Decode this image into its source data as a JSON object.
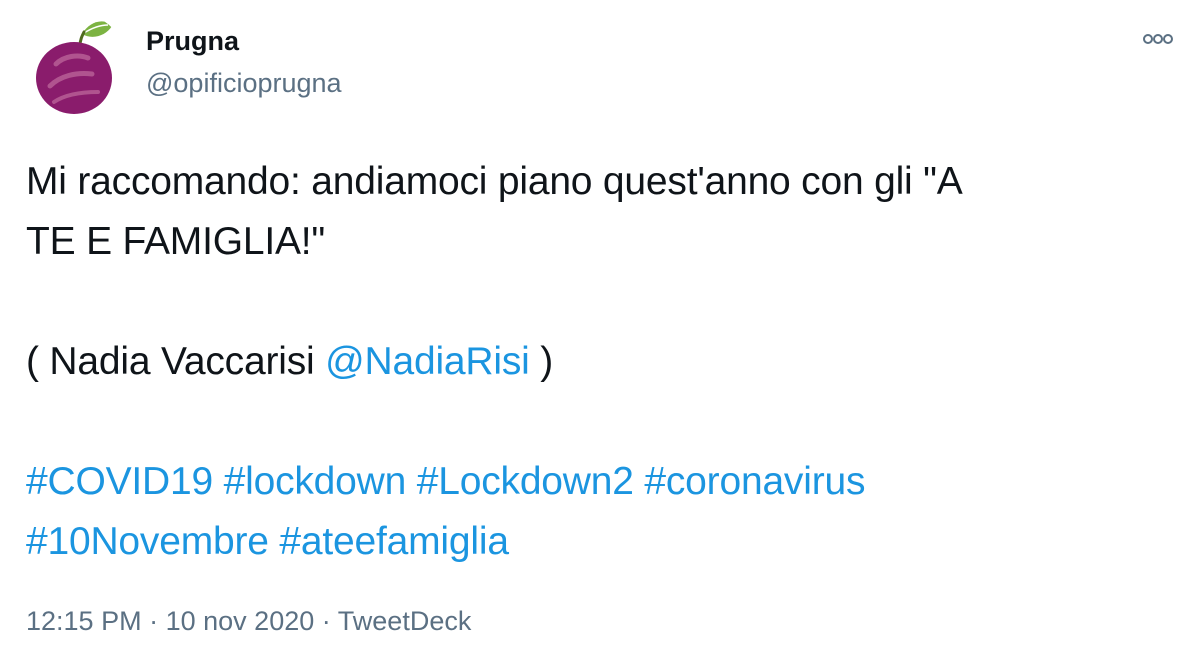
{
  "author": {
    "display_name": "Prugna",
    "handle": "@opificioprugna",
    "avatar_icon": "plum-logo-icon"
  },
  "more_icon": "more-options-icon",
  "tweet": {
    "line1": "Mi raccomando: andiamoci piano quest'anno con gli \"A",
    "line2": "TE E FAMIGLIA!\"",
    "credit_prefix": "( Nadia Vaccarisi ",
    "credit_mention": "@NadiaRisi",
    "credit_suffix": " )",
    "hashtags": [
      "#COVID19",
      "#lockdown",
      "#Lockdown2",
      "#coronavirus",
      "#10Novembre",
      "#ateefamiglia"
    ]
  },
  "meta": {
    "time": "12:15 PM",
    "separator": "·",
    "date": "10 nov 2020",
    "source": "TweetDeck"
  },
  "colors": {
    "link": "#1b95e0",
    "secondary_text": "#5b7083",
    "plum": "#8a1c6c",
    "leaf": "#7cb342"
  }
}
